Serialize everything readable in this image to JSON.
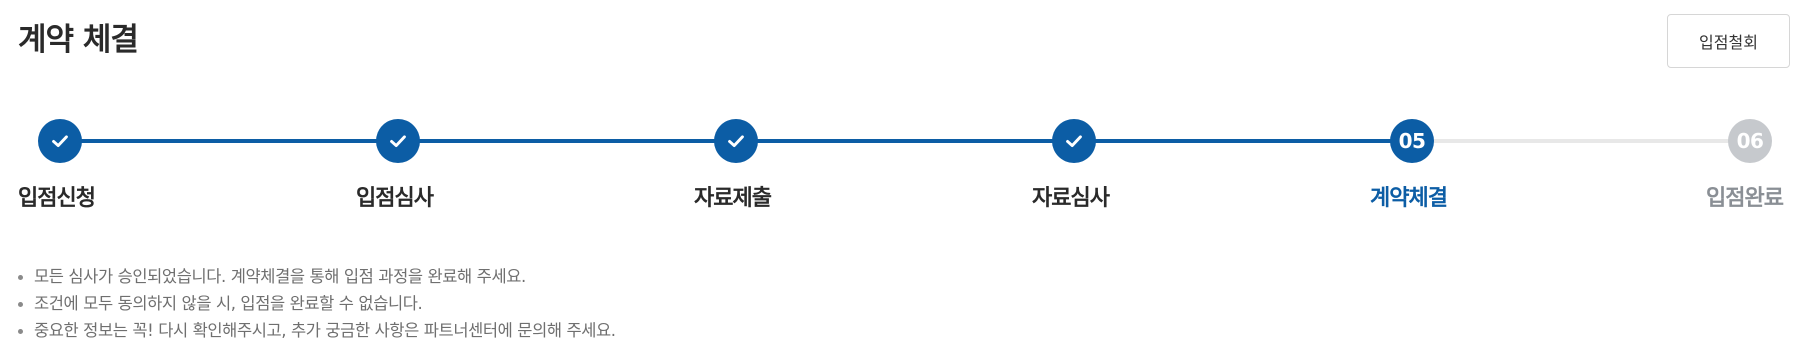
{
  "header": {
    "title": "계약 체결",
    "withdraw_label": "입점철회"
  },
  "steps": [
    {
      "label": "입점신청",
      "state": "done",
      "icon": "check-icon"
    },
    {
      "label": "입점심사",
      "state": "done",
      "icon": "check-icon"
    },
    {
      "label": "자료제출",
      "state": "done",
      "icon": "check-icon"
    },
    {
      "label": "자료심사",
      "state": "done",
      "icon": "check-icon"
    },
    {
      "label": "계약체결",
      "state": "active",
      "number": "05"
    },
    {
      "label": "입점완료",
      "state": "pending",
      "number": "06"
    }
  ],
  "notes": [
    "모든 심사가 승인되었습니다. 계약체결을 통해 입점 과정을 완료해 주세요.",
    "조건에 모두 동의하지 않을 시, 입점을 완료할 수 없습니다.",
    "중요한 정보는 꼭! 다시 확인해주시고, 추가 궁금한 사항은 파트너센터에 문의해 주세요."
  ],
  "colors": {
    "accent": "#0c5da5",
    "pending": "#c6c9cd",
    "track_inactive": "#e8e8e8"
  }
}
